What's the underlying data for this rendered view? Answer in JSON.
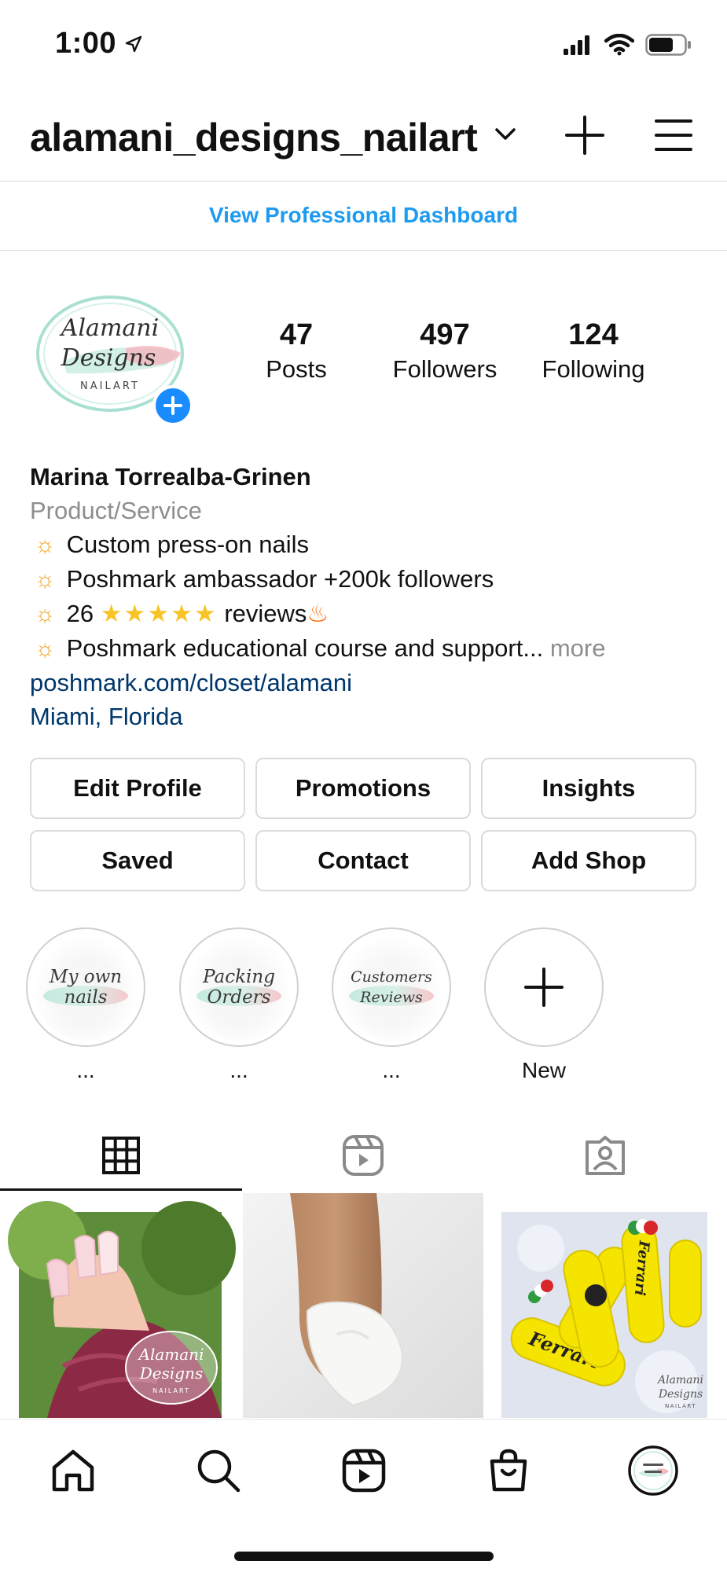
{
  "status": {
    "time": "1:00"
  },
  "header": {
    "username": "alamani_designs_nailart"
  },
  "dashboard_link": "View Professional Dashboard",
  "profile": {
    "avatar_text": {
      "line1": "Alamani",
      "line2": "Designs",
      "line3": "NAILART"
    },
    "stats": [
      {
        "value": "47",
        "label": "Posts"
      },
      {
        "value": "497",
        "label": "Followers"
      },
      {
        "value": "124",
        "label": "Following"
      }
    ]
  },
  "bio": {
    "name": "Marina Torrealba-Grinen",
    "category": "Product/Service",
    "lines": [
      "Custom press-on nails",
      "Poshmark ambassador +200k followers",
      "26",
      "Poshmark educational course and support..."
    ],
    "stars": "★★★★★",
    "reviews_word": "reviews",
    "more": "more",
    "link": "poshmark.com/closet/alamani",
    "location": "Miami, Florida"
  },
  "buttons": {
    "edit_profile": "Edit Profile",
    "promotions": "Promotions",
    "insights": "Insights",
    "saved": "Saved",
    "contact": "Contact",
    "add_shop": "Add Shop"
  },
  "highlights": [
    {
      "cover_line1": "My own",
      "cover_line2": "nails",
      "label": "..."
    },
    {
      "cover_line1": "Packing",
      "cover_line2": "Orders",
      "label": "..."
    },
    {
      "cover_line1": "Customers",
      "cover_line2": "Reviews",
      "label": "..."
    },
    {
      "label": "New"
    }
  ],
  "posts": [
    {
      "watermark1": "Alamani",
      "watermark2": "Designs",
      "watermark3": "NAILART"
    },
    {},
    {
      "brand_text1": "Ferrari",
      "brand_text2": "Ferrari",
      "watermark1": "Alamani",
      "watermark2": "Designs",
      "watermark3": "NAILART"
    }
  ],
  "colors": {
    "accent_blue": "#1d9bf0",
    "link_blue": "#00376b",
    "muted_gray": "#8e8e8e",
    "border_gray": "#dbdbdb"
  },
  "icons": {
    "tabs": [
      "grid-icon",
      "reels-icon",
      "tagged-icon"
    ],
    "bottom_nav": [
      "home-icon",
      "search-icon",
      "reels-icon",
      "shop-icon",
      "profile-avatar-icon"
    ]
  }
}
